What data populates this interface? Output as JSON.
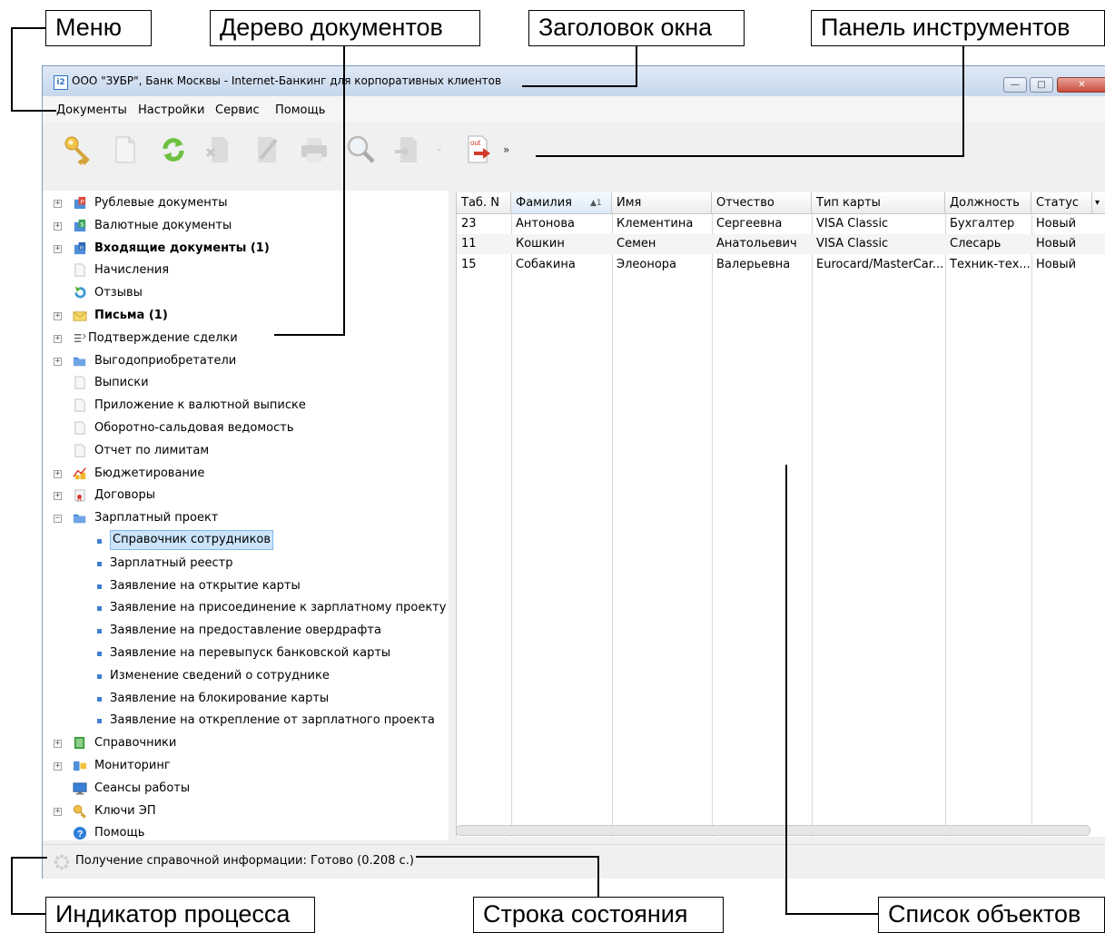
{
  "callouts": {
    "menu": "Меню",
    "doc_tree": "Дерево документов",
    "window_title": "Заголовок окна",
    "toolbar": "Панель инструментов",
    "progress": "Индикатор процесса",
    "statusbar": "Строка состояния",
    "object_list": "Список объектов"
  },
  "window": {
    "title": "ООО \"ЗУБР\", Банк Москвы - Internet-Банкинг для корпоративных клиентов",
    "icon": "app-icon",
    "controls": [
      "minimize-icon",
      "maximize-icon",
      "close-icon"
    ]
  },
  "menu": [
    "Документы",
    "Настройки",
    "Сервис",
    "Помощь"
  ],
  "toolbar": {
    "icons": [
      "keys-icon",
      "new-document-icon",
      "refresh-icon",
      "delete-document-icon",
      "edit-document-icon",
      "print-icon",
      "search-icon",
      "export-icon",
      "out-icon",
      "more-chevron-icon"
    ],
    "out_label": "out"
  },
  "tree": {
    "items": [
      {
        "label": "Рублевые документы",
        "icon": "ruble-folder-icon",
        "expander": "+",
        "bold": false,
        "level": 0
      },
      {
        "label": "Валютные документы",
        "icon": "currency-folder-icon",
        "expander": "+",
        "bold": false,
        "level": 0
      },
      {
        "label": "Входящие документы (1)",
        "icon": "incoming-folder-icon",
        "expander": "+",
        "bold": true,
        "level": 0
      },
      {
        "label": "Начисления",
        "icon": "document-icon",
        "expander": "",
        "bold": false,
        "level": 0
      },
      {
        "label": "Отзывы",
        "icon": "recall-icon",
        "expander": "",
        "bold": false,
        "level": 0
      },
      {
        "label": "Письма (1)",
        "icon": "envelope-icon",
        "expander": "+",
        "bold": true,
        "level": 0
      },
      {
        "label": "Подтверждение сделки",
        "icon": "list-icon",
        "expander": "+",
        "bold": false,
        "level": 0
      },
      {
        "label": "Выгодоприобретатели",
        "icon": "folder-icon",
        "expander": "+",
        "bold": false,
        "level": 0
      },
      {
        "label": "Выписки",
        "icon": "document-icon",
        "expander": "",
        "bold": false,
        "level": 0
      },
      {
        "label": "Приложение к валютной выписке",
        "icon": "document-icon",
        "expander": "",
        "bold": false,
        "level": 0
      },
      {
        "label": "Оборотно-сальдовая ведомость",
        "icon": "document-icon",
        "expander": "",
        "bold": false,
        "level": 0
      },
      {
        "label": "Отчет по лимитам",
        "icon": "document-icon",
        "expander": "",
        "bold": false,
        "level": 0
      },
      {
        "label": "Бюджетирование",
        "icon": "budget-chart-icon",
        "expander": "+",
        "bold": false,
        "level": 0
      },
      {
        "label": "Договоры",
        "icon": "contract-icon",
        "expander": "+",
        "bold": false,
        "level": 0
      },
      {
        "label": "Зарплатный проект",
        "icon": "folder-icon",
        "expander": "−",
        "bold": false,
        "level": 0
      },
      {
        "label": "Справочник сотрудников",
        "icon": "bullet",
        "expander": "",
        "bold": false,
        "level": 1,
        "selected": true
      },
      {
        "label": "Зарплатный реестр",
        "icon": "bullet",
        "expander": "",
        "bold": false,
        "level": 1
      },
      {
        "label": "Заявление на открытие карты",
        "icon": "bullet",
        "expander": "",
        "bold": false,
        "level": 1
      },
      {
        "label": "Заявление на присоединение к зарплатному проекту",
        "icon": "bullet",
        "expander": "",
        "bold": false,
        "level": 1
      },
      {
        "label": "Заявление на предоставление овердрафта",
        "icon": "bullet",
        "expander": "",
        "bold": false,
        "level": 1
      },
      {
        "label": "Заявление на перевыпуск банковской карты",
        "icon": "bullet",
        "expander": "",
        "bold": false,
        "level": 1
      },
      {
        "label": "Изменение сведений о сотруднике",
        "icon": "bullet",
        "expander": "",
        "bold": false,
        "level": 1
      },
      {
        "label": "Заявление на блокирование карты",
        "icon": "bullet",
        "expander": "",
        "bold": false,
        "level": 1
      },
      {
        "label": "Заявление на открепление от зарплатного проекта",
        "icon": "bullet",
        "expander": "",
        "bold": false,
        "level": 1
      },
      {
        "label": "Справочники",
        "icon": "book-icon",
        "expander": "+",
        "bold": false,
        "level": 0
      },
      {
        "label": "Мониторинг",
        "icon": "monitoring-icon",
        "expander": "+",
        "bold": false,
        "level": 0
      },
      {
        "label": "Сеансы работы",
        "icon": "monitor-icon",
        "expander": "",
        "bold": false,
        "level": 0
      },
      {
        "label": "Ключи ЭП",
        "icon": "key-icon",
        "expander": "+",
        "bold": false,
        "level": 0
      },
      {
        "label": "Помощь",
        "icon": "help-icon",
        "expander": "",
        "bold": false,
        "level": 0
      }
    ]
  },
  "grid": {
    "columns": [
      "Таб. N",
      "Фамилия",
      "Имя",
      "Отчество",
      "Тип карты",
      "Должность",
      "Статус"
    ],
    "sort_indicator": "▲1",
    "column_menu_glyph": "▾",
    "rows": [
      [
        "23",
        "Антонова",
        "Клементина",
        "Сергеевна",
        "VISA Classic",
        "Бухгалтер",
        "Новый"
      ],
      [
        "11",
        "Кошкин",
        "Семен",
        "Анатольевич",
        "VISA Classic",
        "Слесарь",
        "Новый"
      ],
      [
        "15",
        "Собакина",
        "Элеонора",
        "Валерьевна",
        "Eurocard/MasterCar...",
        "Техник-тех...",
        "Новый"
      ]
    ]
  },
  "status": {
    "text": "Получение справочной информации: Готово (0.208 с.)",
    "icon": "progress-spinner-icon"
  }
}
